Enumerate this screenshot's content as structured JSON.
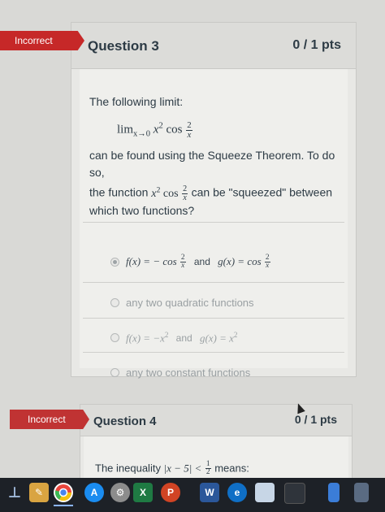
{
  "question3": {
    "badge": "Incorrect",
    "title": "Question 3",
    "points": "0 / 1 pts",
    "prompt_intro": "The following limit:",
    "limit_text": "lim",
    "limit_sub": "x→0",
    "limit_expr_base": "x",
    "limit_expr_exp": "2",
    "limit_cos": "cos",
    "frac_num": "2",
    "frac_den": "x",
    "prompt_body_1": "can be found using the Squeeze Theorem. To do so,",
    "prompt_body_2a": "the function",
    "prompt_body_2b": "can be \"squeezed\" between",
    "prompt_body_3": "which two functions?",
    "answers": [
      {
        "f_label": "f(x) = − cos",
        "and": "and",
        "g_label": "g(x) = cos",
        "selected": true
      },
      {
        "text": "any two quadratic functions",
        "selected": false
      },
      {
        "f_label": "f(x) = −x",
        "f_exp": "2",
        "and": "and",
        "g_label": "g(x) = x",
        "g_exp": "2",
        "selected": false
      },
      {
        "text": "any two constant functions",
        "selected": false
      }
    ]
  },
  "question4": {
    "badge": "Incorrect",
    "title": "Question 4",
    "points": "0 / 1 pts",
    "prompt_start": "The inequality",
    "abs_expr": "|x − 5| <",
    "half_num": "1",
    "half_den": "2",
    "prompt_end": "means:"
  },
  "taskbar": {
    "icons": [
      "pin-icon",
      "paint-icon",
      "chrome-icon",
      "app-store-icon",
      "settings-icon",
      "excel-icon",
      "powerpoint-icon",
      "word-icon",
      "edge-icon",
      "photos-icon",
      "window-icon",
      "finder-icon",
      "trash-icon"
    ],
    "colors": {
      "chrome": "#e8453c",
      "excel": "#1f7a43",
      "powerpoint": "#d14424",
      "word": "#2b579a",
      "edge": "#0f6fc6"
    }
  }
}
